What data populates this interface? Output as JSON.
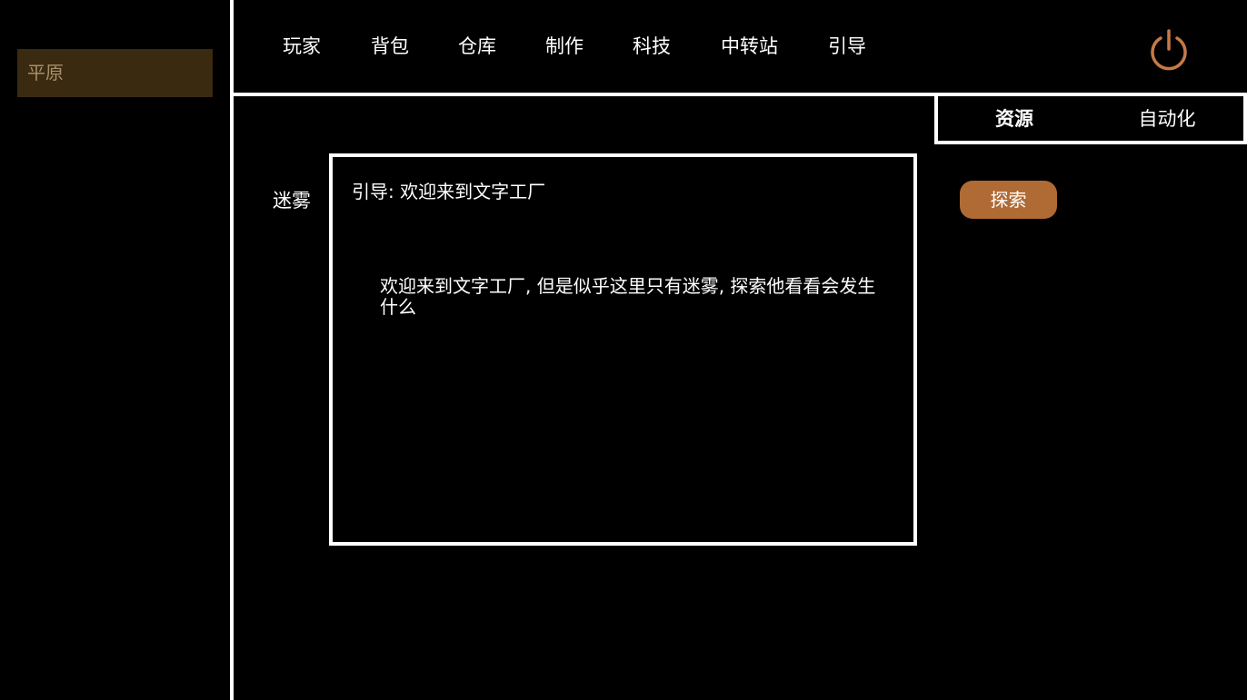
{
  "sidebar": {
    "locations": [
      {
        "label": "平原",
        "selected": true
      }
    ]
  },
  "nav": {
    "items": [
      {
        "label": "玩家"
      },
      {
        "label": "背包"
      },
      {
        "label": "仓库"
      },
      {
        "label": "制作"
      },
      {
        "label": "科技"
      },
      {
        "label": "中转站"
      },
      {
        "label": "引导"
      }
    ],
    "power_icon": "power-icon"
  },
  "tabs": [
    {
      "label": "资源",
      "active": true
    },
    {
      "label": "自动化",
      "active": false
    }
  ],
  "resources": [
    {
      "name": "迷雾"
    }
  ],
  "actions": {
    "explore_label": "探索"
  },
  "dialog": {
    "title": "引导: 欢迎来到文字工厂",
    "body": "欢迎来到文字工厂, 但是似乎这里只有迷雾, 探索他看看会发生什么"
  },
  "colors": {
    "accent": "#b06a34",
    "power_icon": "#c47a46",
    "sidebar_selected_bg": "#3a2a10",
    "sidebar_selected_text": "#a88f6a",
    "divider": "#ffffff",
    "background": "#000000"
  }
}
